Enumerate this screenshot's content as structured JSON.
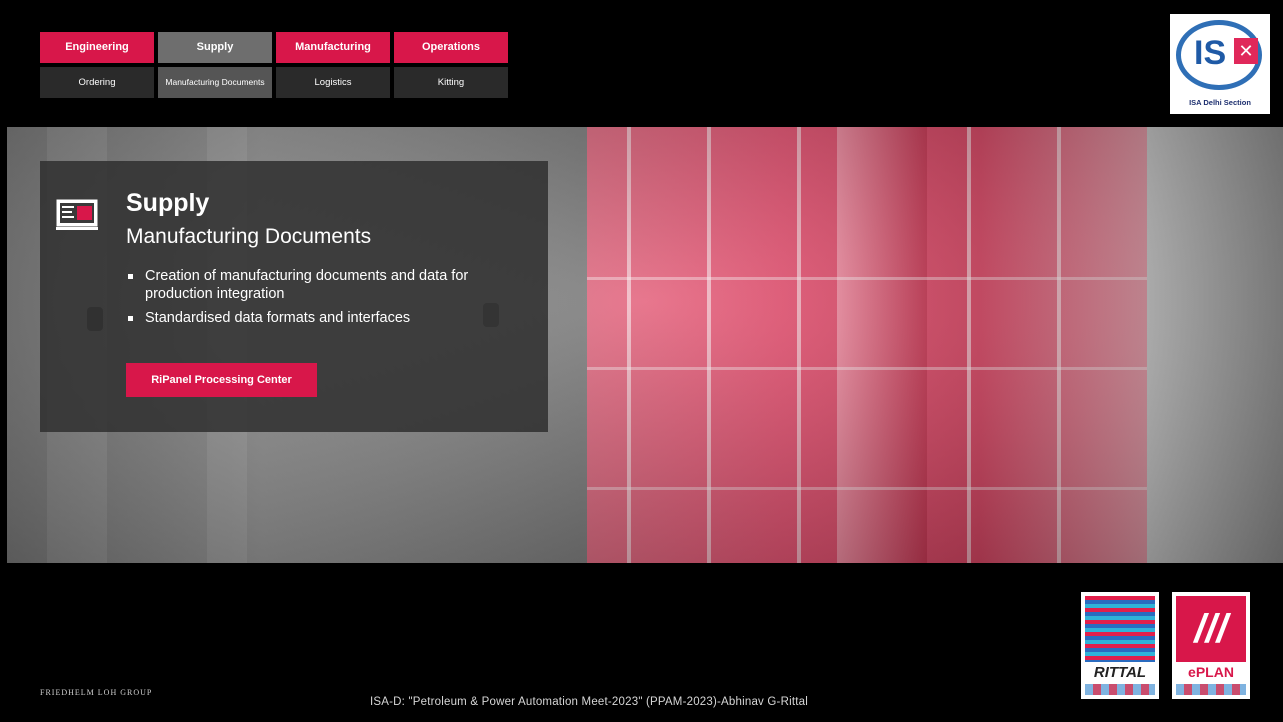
{
  "nav": {
    "top": [
      {
        "label": "Engineering",
        "style": "red"
      },
      {
        "label": "Supply",
        "style": "grey"
      },
      {
        "label": "Manufacturing",
        "style": "red"
      },
      {
        "label": "Operations",
        "style": "red"
      }
    ],
    "bottom": [
      {
        "label": "Ordering"
      },
      {
        "label": "Manufacturing Documents"
      },
      {
        "label": "Logistics"
      },
      {
        "label": "Kitting"
      }
    ]
  },
  "isa_logo": {
    "letters": "IS",
    "caption": "ISA Delhi Section"
  },
  "card": {
    "icon": "monitor-document-icon",
    "title": "Supply",
    "subtitle": "Manufacturing Documents",
    "bullets": [
      "Creation of manufacturing documents and data for production integration",
      "Standardised data formats and interfaces"
    ],
    "button_label": "RiPanel Processing Center"
  },
  "footer": {
    "group_name": "FRIEDHELM LOH GROUP",
    "event_line": "ISA-D: \"Petroleum & Power Automation Meet-2023\" (PPAM-2023)-Abhinav G-Rittal",
    "rittal_text": "RITTAL",
    "eplan_text": "ePLAN",
    "eplan_mark": "///"
  },
  "colors": {
    "accent": "#d8174a",
    "selected": "#6e6e6e"
  }
}
